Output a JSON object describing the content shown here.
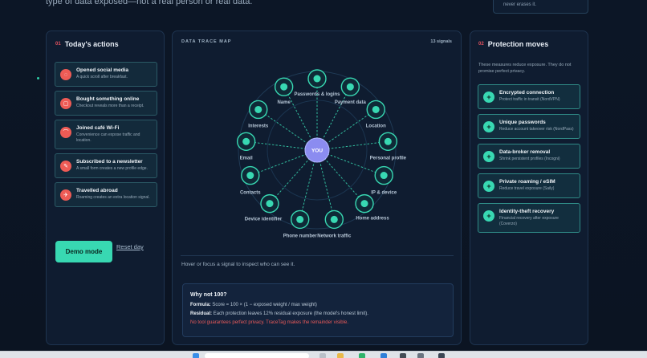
{
  "page": {
    "top_text": "type of data exposed—not a real person or real data.",
    "top_card_text": "never erases it."
  },
  "actions_panel": {
    "num": "01",
    "title": "Today's actions",
    "items": [
      {
        "icon": "social-icon",
        "title": "Opened social media",
        "subtitle": "A quick scroll after breakfast."
      },
      {
        "icon": "bag-icon",
        "title": "Bought something online",
        "subtitle": "Checkout reveals more than a receipt."
      },
      {
        "icon": "wifi-icon",
        "title": "Joined café Wi-Fi",
        "subtitle": "Convenience can expose traffic and location."
      },
      {
        "icon": "pen-icon",
        "title": "Subscribed to a newsletter",
        "subtitle": "A small form creates a new profile edge."
      },
      {
        "icon": "plane-icon",
        "title": "Travelled abroad",
        "subtitle": "Roaming creates an extra location signal."
      }
    ],
    "demo_button": "Demo mode",
    "reset_link": "Reset day"
  },
  "map_panel": {
    "title": "DATA TRACE MAP",
    "count": "13 signals",
    "center_label": "YOU",
    "nodes": [
      {
        "label": "Passwords & logins"
      },
      {
        "label": "Payment data"
      },
      {
        "label": "Location"
      },
      {
        "label": "Personal profile"
      },
      {
        "label": "IP & device"
      },
      {
        "label": "Home address"
      },
      {
        "label": "Network traffic"
      },
      {
        "label": "Phone number"
      },
      {
        "label": "Device identifier"
      },
      {
        "label": "Contacts"
      },
      {
        "label": "Email"
      },
      {
        "label": "Interests"
      },
      {
        "label": "Name"
      }
    ],
    "hint": "Hover or focus a signal to inspect who can see it.",
    "why": {
      "title": "Why not 100?",
      "formula_label": "Formula:",
      "formula": "Score = 100 × (1 − exposed weight / max weight)",
      "residual_label": "Residual:",
      "residual": "Each protection leaves 12% residual exposure (the model's honest limit).",
      "warning": "No tool guarantees perfect privacy. TraceTag makes the remainder visible."
    }
  },
  "protection_panel": {
    "num": "02",
    "title": "Protection moves",
    "intro": "These measures reduce exposure. They do not promise perfect privacy.",
    "items": [
      {
        "title": "Encrypted connection",
        "subtitle": "Protect traffic in transit (NordVPN)"
      },
      {
        "title": "Unique passwords",
        "subtitle": "Reduce account takeover risk (NordPass)"
      },
      {
        "title": "Data-broker removal",
        "subtitle": "Shrink persistent profiles (Incogni)"
      },
      {
        "title": "Private roaming / eSIM",
        "subtitle": "Reduce travel exposure (Saily)"
      },
      {
        "title": "Identity-theft recovery",
        "subtitle": "Financial recovery after exposure (Coverzo)"
      }
    ]
  },
  "colors": {
    "accent": "#38d8b2",
    "danger": "#ee5b55",
    "center": "#8b8cf0",
    "background": "#0c1626"
  }
}
